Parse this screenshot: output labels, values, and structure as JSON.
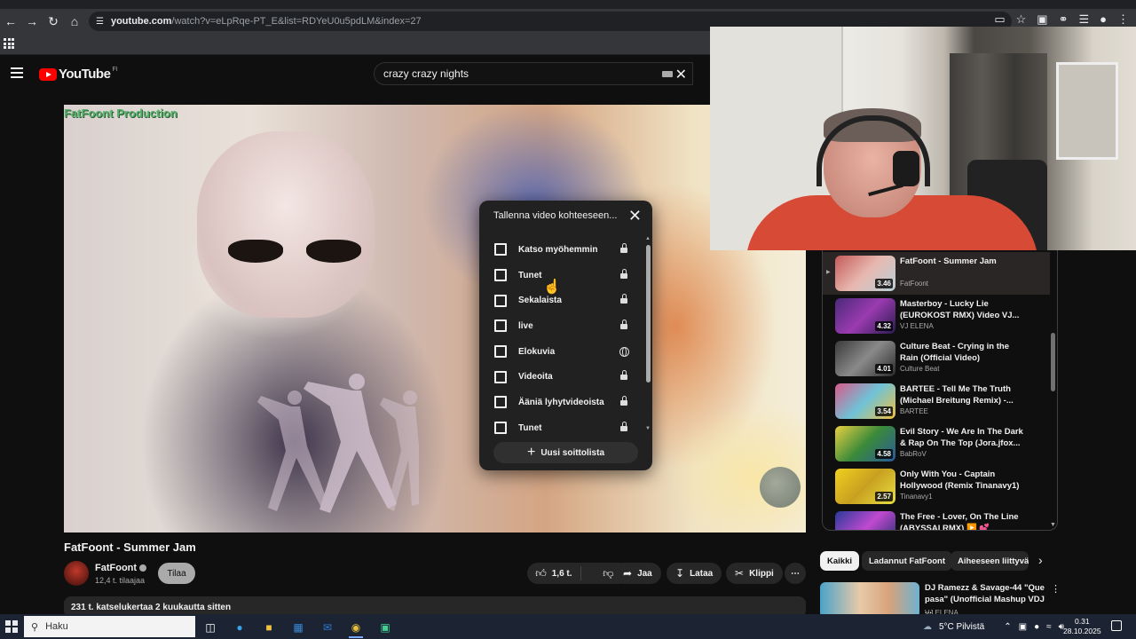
{
  "browser": {
    "url_host": "youtube.com",
    "url_path": "/watch?v=eLpRqe-PT_E&list=RDYeU0u5pdLM&index=27"
  },
  "youtube": {
    "logo_text": "YouTube",
    "logo_country": "FI",
    "search_query": "crazy crazy nights"
  },
  "video": {
    "watermark": "FatFoont Production",
    "title": "FatFoont - Summer Jam",
    "channel": "FatFoont",
    "subscribers": "12,4 t. tilaajaa",
    "subscribe_label": "Tilaa",
    "likes": "1,6 t.",
    "share_label": "Jaa",
    "download_label": "Lataa",
    "clip_label": "Klippi",
    "views_line": "231 t. katselukertaa  2 kuukautta sitten"
  },
  "save_dialog": {
    "title": "Tallenna video kohteeseen...",
    "playlists": [
      {
        "name": "Katso myöhemmin",
        "privacy": "lock-icon"
      },
      {
        "name": "Tunet",
        "privacy": "lock-icon"
      },
      {
        "name": "Sekalaista",
        "privacy": "lock-icon"
      },
      {
        "name": "live",
        "privacy": "lock-icon"
      },
      {
        "name": "Elokuvia",
        "privacy": "globe-icon"
      },
      {
        "name": "Videoita",
        "privacy": "lock-icon"
      },
      {
        "name": "Ääniä lyhytvideoista",
        "privacy": "lock-icon"
      },
      {
        "name": "Tunet",
        "privacy": "lock-icon"
      }
    ],
    "new_playlist_label": "Uusi soittolista"
  },
  "playlist_panel": {
    "items": [
      {
        "title": "FatFoont - Summer Jam",
        "channel": "FatFoont",
        "duration": "3.46",
        "active": true
      },
      {
        "title": "Masterboy - Lucky Lie (EUROKOST RMX) Video VJ...",
        "channel": "VJ ELENA",
        "duration": "4.32"
      },
      {
        "title": "Culture Beat - Crying in the Rain (Official Video)",
        "channel": "Culture Beat",
        "duration": "4.01"
      },
      {
        "title": "BARTEE - Tell Me The Truth (Michael Breitung Remix) -...",
        "channel": "BARTEE",
        "duration": "3.54"
      },
      {
        "title": "Evil Story - We Are In The Dark & Rap On The Top (Jora.jfox...",
        "channel": "BabRoV",
        "duration": "4.58"
      },
      {
        "title": "Only With You - Captain Hollywood (Remix Tinanavy1)",
        "channel": "Tinanavy1",
        "duration": "2.57"
      },
      {
        "title": "The Free - Lover, On The Line (ABYSSAI RMX) ▶️ 💕",
        "channel": "",
        "duration": ""
      }
    ]
  },
  "chips": [
    "Kaikki",
    "Ladannut FatFoont",
    "Aiheeseen liittyvät"
  ],
  "recommendation": {
    "title": "DJ Ramezz & Savage-44 \"Que pasa\" (Unofficial Mashup VDJ ...",
    "channel": "VJ ELENA"
  },
  "taskbar": {
    "search_placeholder": "Haku",
    "weather": "5°C  Pilvistä",
    "time": "0.31",
    "date": "28.10.2025"
  },
  "colors": {
    "accent_red": "#ff0000",
    "background": "#0f0f0f",
    "watermark_green": "#55b36b"
  }
}
